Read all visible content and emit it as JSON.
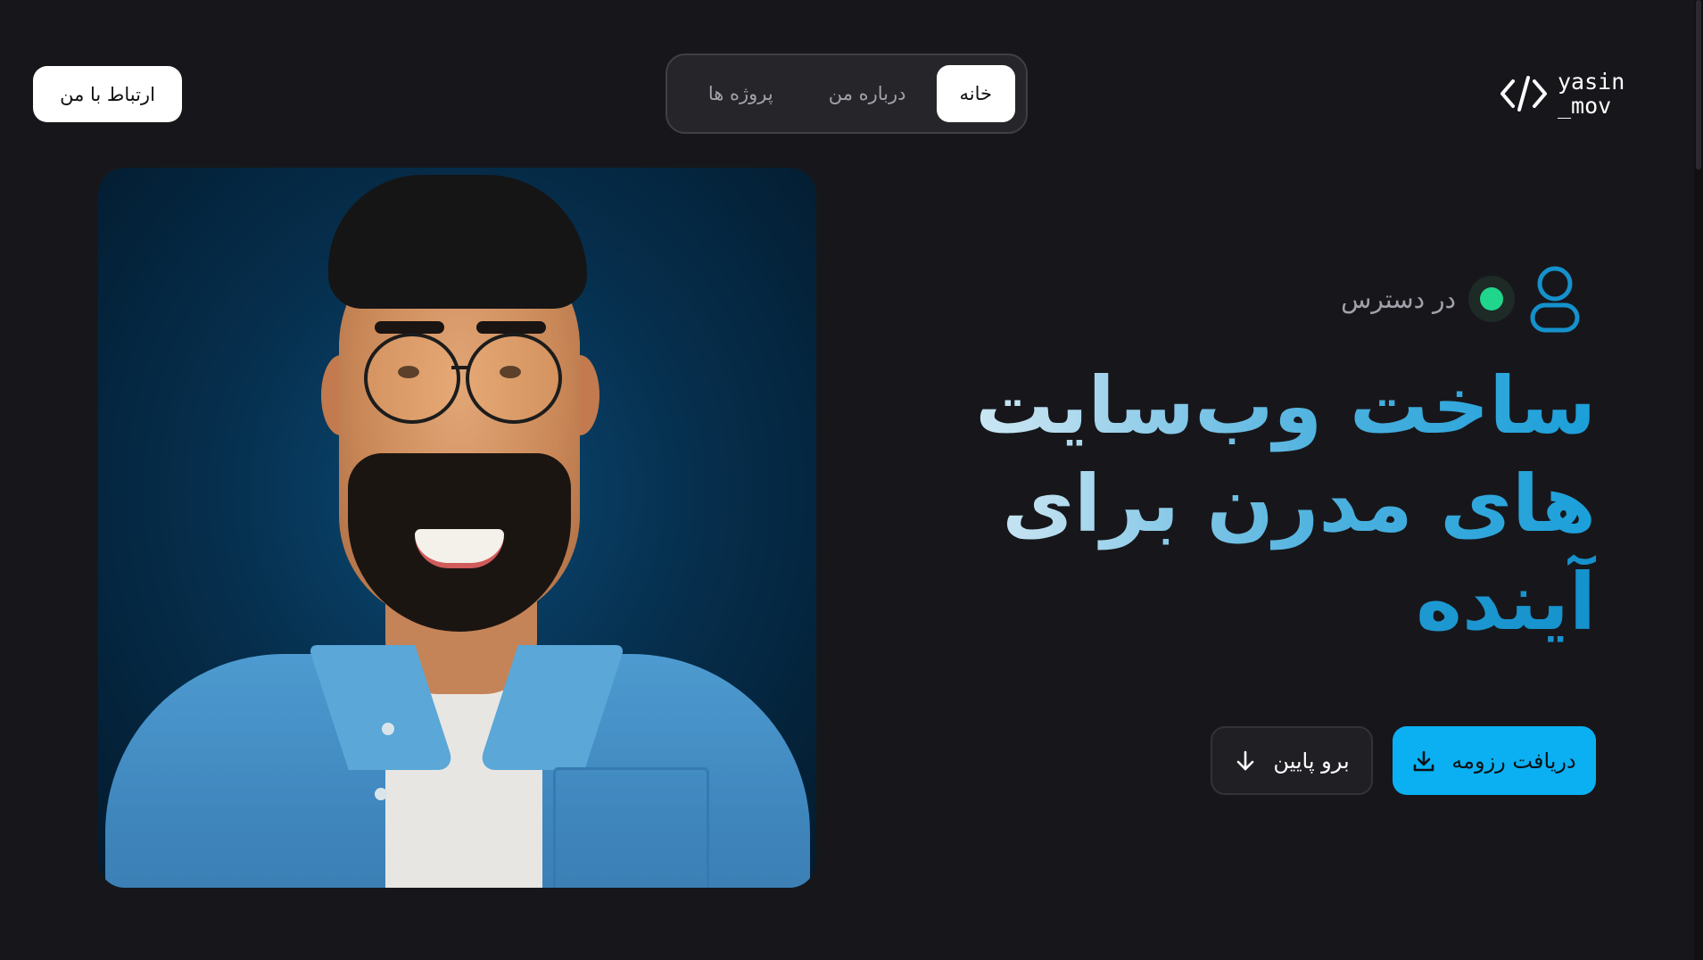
{
  "header": {
    "contact_label": "ارتباط با من",
    "nav": [
      {
        "label": "خانه",
        "active": true
      },
      {
        "label": "درباره من",
        "active": false
      },
      {
        "label": "پروژه ها",
        "active": false
      }
    ],
    "logo_line1": "yasin",
    "logo_line2": "_mov"
  },
  "hero": {
    "status_text": "در دسترس",
    "headline_lines": [
      "ساخت وب‌سایت",
      "های مدرن برای",
      "آینده"
    ],
    "resume_label": "دریافت رزومه",
    "scroll_label": "برو پایین"
  },
  "colors": {
    "background": "#17171b",
    "accent": "#0ab0f2",
    "status_green": "#1fd68c"
  },
  "icons": {
    "logo": "code-brackets-icon",
    "status": "user-icon",
    "resume": "download-icon",
    "scroll": "arrow-down-icon"
  }
}
